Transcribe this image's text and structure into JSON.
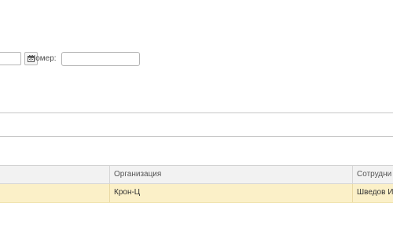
{
  "filter": {
    "number_label": "Номер:",
    "number_value": ""
  },
  "table": {
    "columns": [
      "",
      "Организация",
      "Сотрудни"
    ],
    "rows": [
      {
        "col1": "",
        "organization": "Крон-Ц",
        "employee": "Шведов И"
      }
    ]
  },
  "colors": {
    "selected_row": "#fbf0c8",
    "header_bg": "#f2f2f2"
  },
  "icons": {
    "calendar": "calendar-icon"
  }
}
